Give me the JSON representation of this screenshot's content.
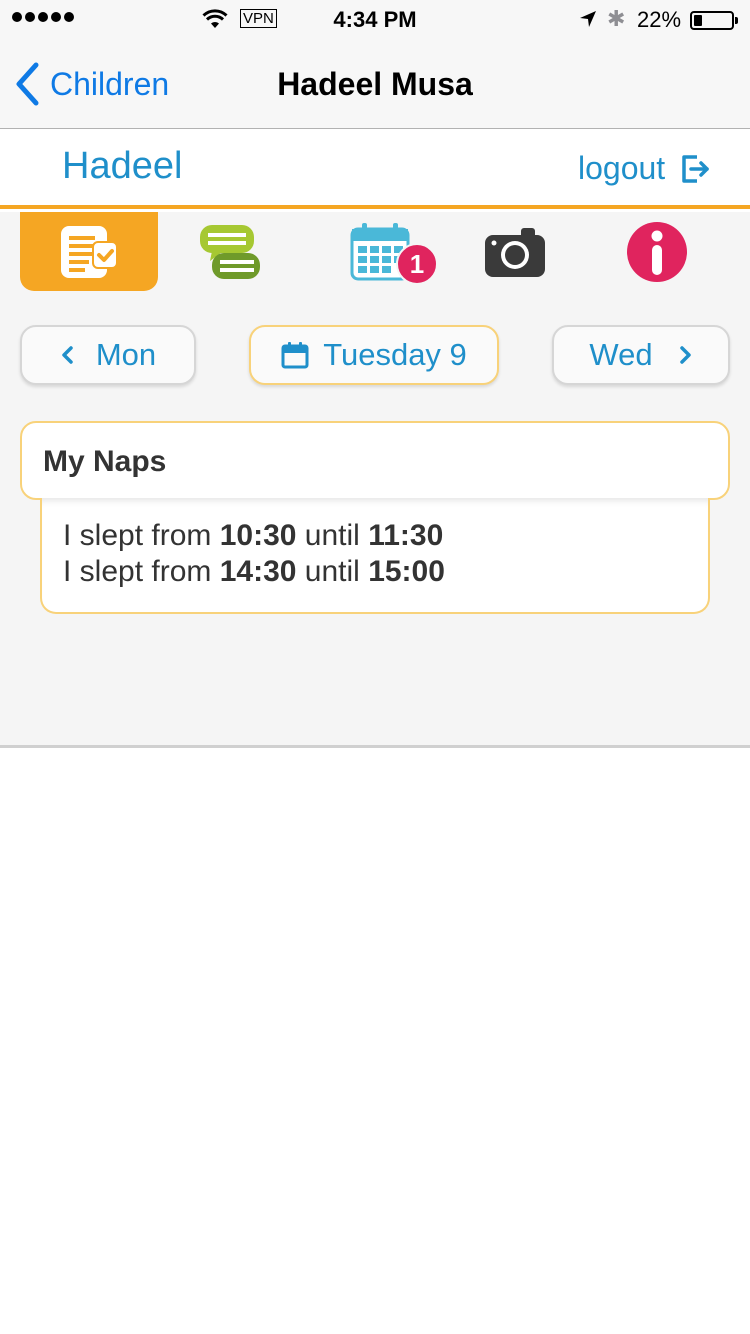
{
  "status_bar": {
    "signal_icon": "signal-dots-icon",
    "wifi_icon": "wifi-icon",
    "vpn_label": "VPN",
    "time": "4:34 PM",
    "location_icon": "location-arrow-icon",
    "bluetooth_icon": "bluetooth-icon",
    "battery_percent": "22%",
    "battery_level": 0.22
  },
  "nav_bar": {
    "back_label": "Children",
    "title": "Hadeel Musa",
    "tint_color": "#0f7ae5"
  },
  "child_header": {
    "name": "Hadeel",
    "logout_label": "logout",
    "accent_color": "#f5a623",
    "text_color": "#1f8fca"
  },
  "tabs": [
    {
      "icon": "daily-report-icon",
      "active": true
    },
    {
      "icon": "chat-bubbles-icon",
      "active": false
    },
    {
      "icon": "calendar-icon",
      "active": false,
      "badge": "1"
    },
    {
      "icon": "camera-icon",
      "active": false
    },
    {
      "icon": "info-icon",
      "active": false
    }
  ],
  "day_nav": {
    "prev_label": "Mon",
    "current_label": "Tuesday 9",
    "next_label": "Wed"
  },
  "naps_card": {
    "title": "My Naps",
    "entries": [
      {
        "prefix": "I slept from",
        "start": "10:30",
        "middle": "until",
        "end": "11:30"
      },
      {
        "prefix": "I slept from",
        "start": "14:30",
        "middle": "until",
        "end": "15:00"
      }
    ]
  }
}
